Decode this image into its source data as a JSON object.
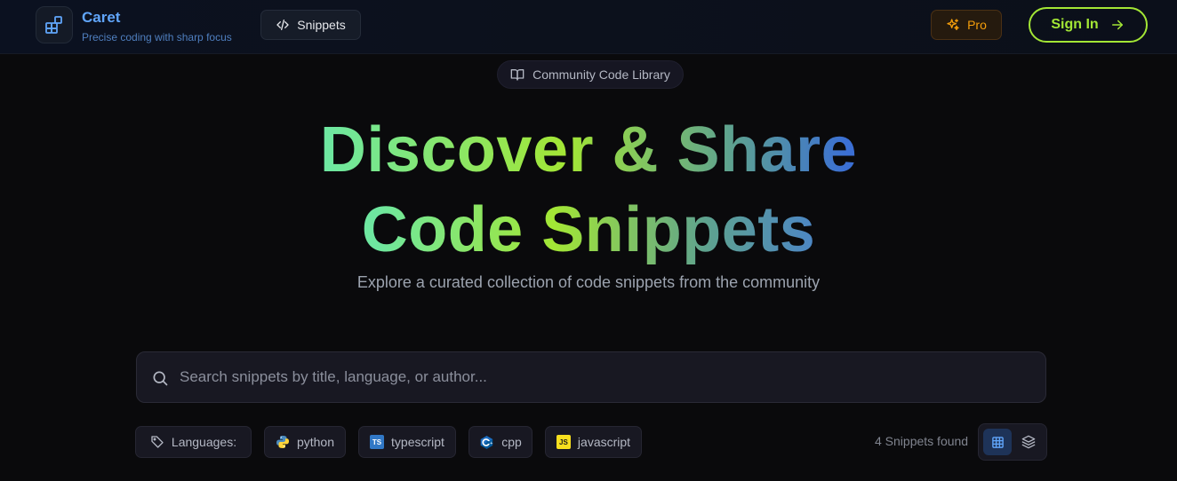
{
  "header": {
    "brand_name": "Caret",
    "brand_tagline": "Precise coding with sharp focus",
    "nav_snippets": "Snippets",
    "pro_label": "Pro",
    "sign_in_label": "Sign In"
  },
  "hero": {
    "pill_label": "Community Code Library",
    "headline_line1": "Discover & Share",
    "headline_line2": "Code Snippets",
    "subtitle": "Explore a curated collection of code snippets from the community"
  },
  "search": {
    "placeholder": "Search snippets by title, language, or author...",
    "value": ""
  },
  "filters": {
    "languages_label": "Languages:",
    "languages": [
      {
        "name": "python",
        "icon": "python-icon"
      },
      {
        "name": "typescript",
        "icon": "typescript-icon",
        "badge": "TS"
      },
      {
        "name": "cpp",
        "icon": "cpp-icon"
      },
      {
        "name": "javascript",
        "icon": "javascript-icon",
        "badge": "JS"
      }
    ],
    "count_text": "4 Snippets found",
    "view_modes": [
      "grid-view-icon",
      "list-view-icon"
    ]
  },
  "colors": {
    "accent_lime": "#a3e635",
    "accent_blue": "#60a5fa",
    "pro_amber": "#f59e0b",
    "background": "#0a0a0c"
  }
}
